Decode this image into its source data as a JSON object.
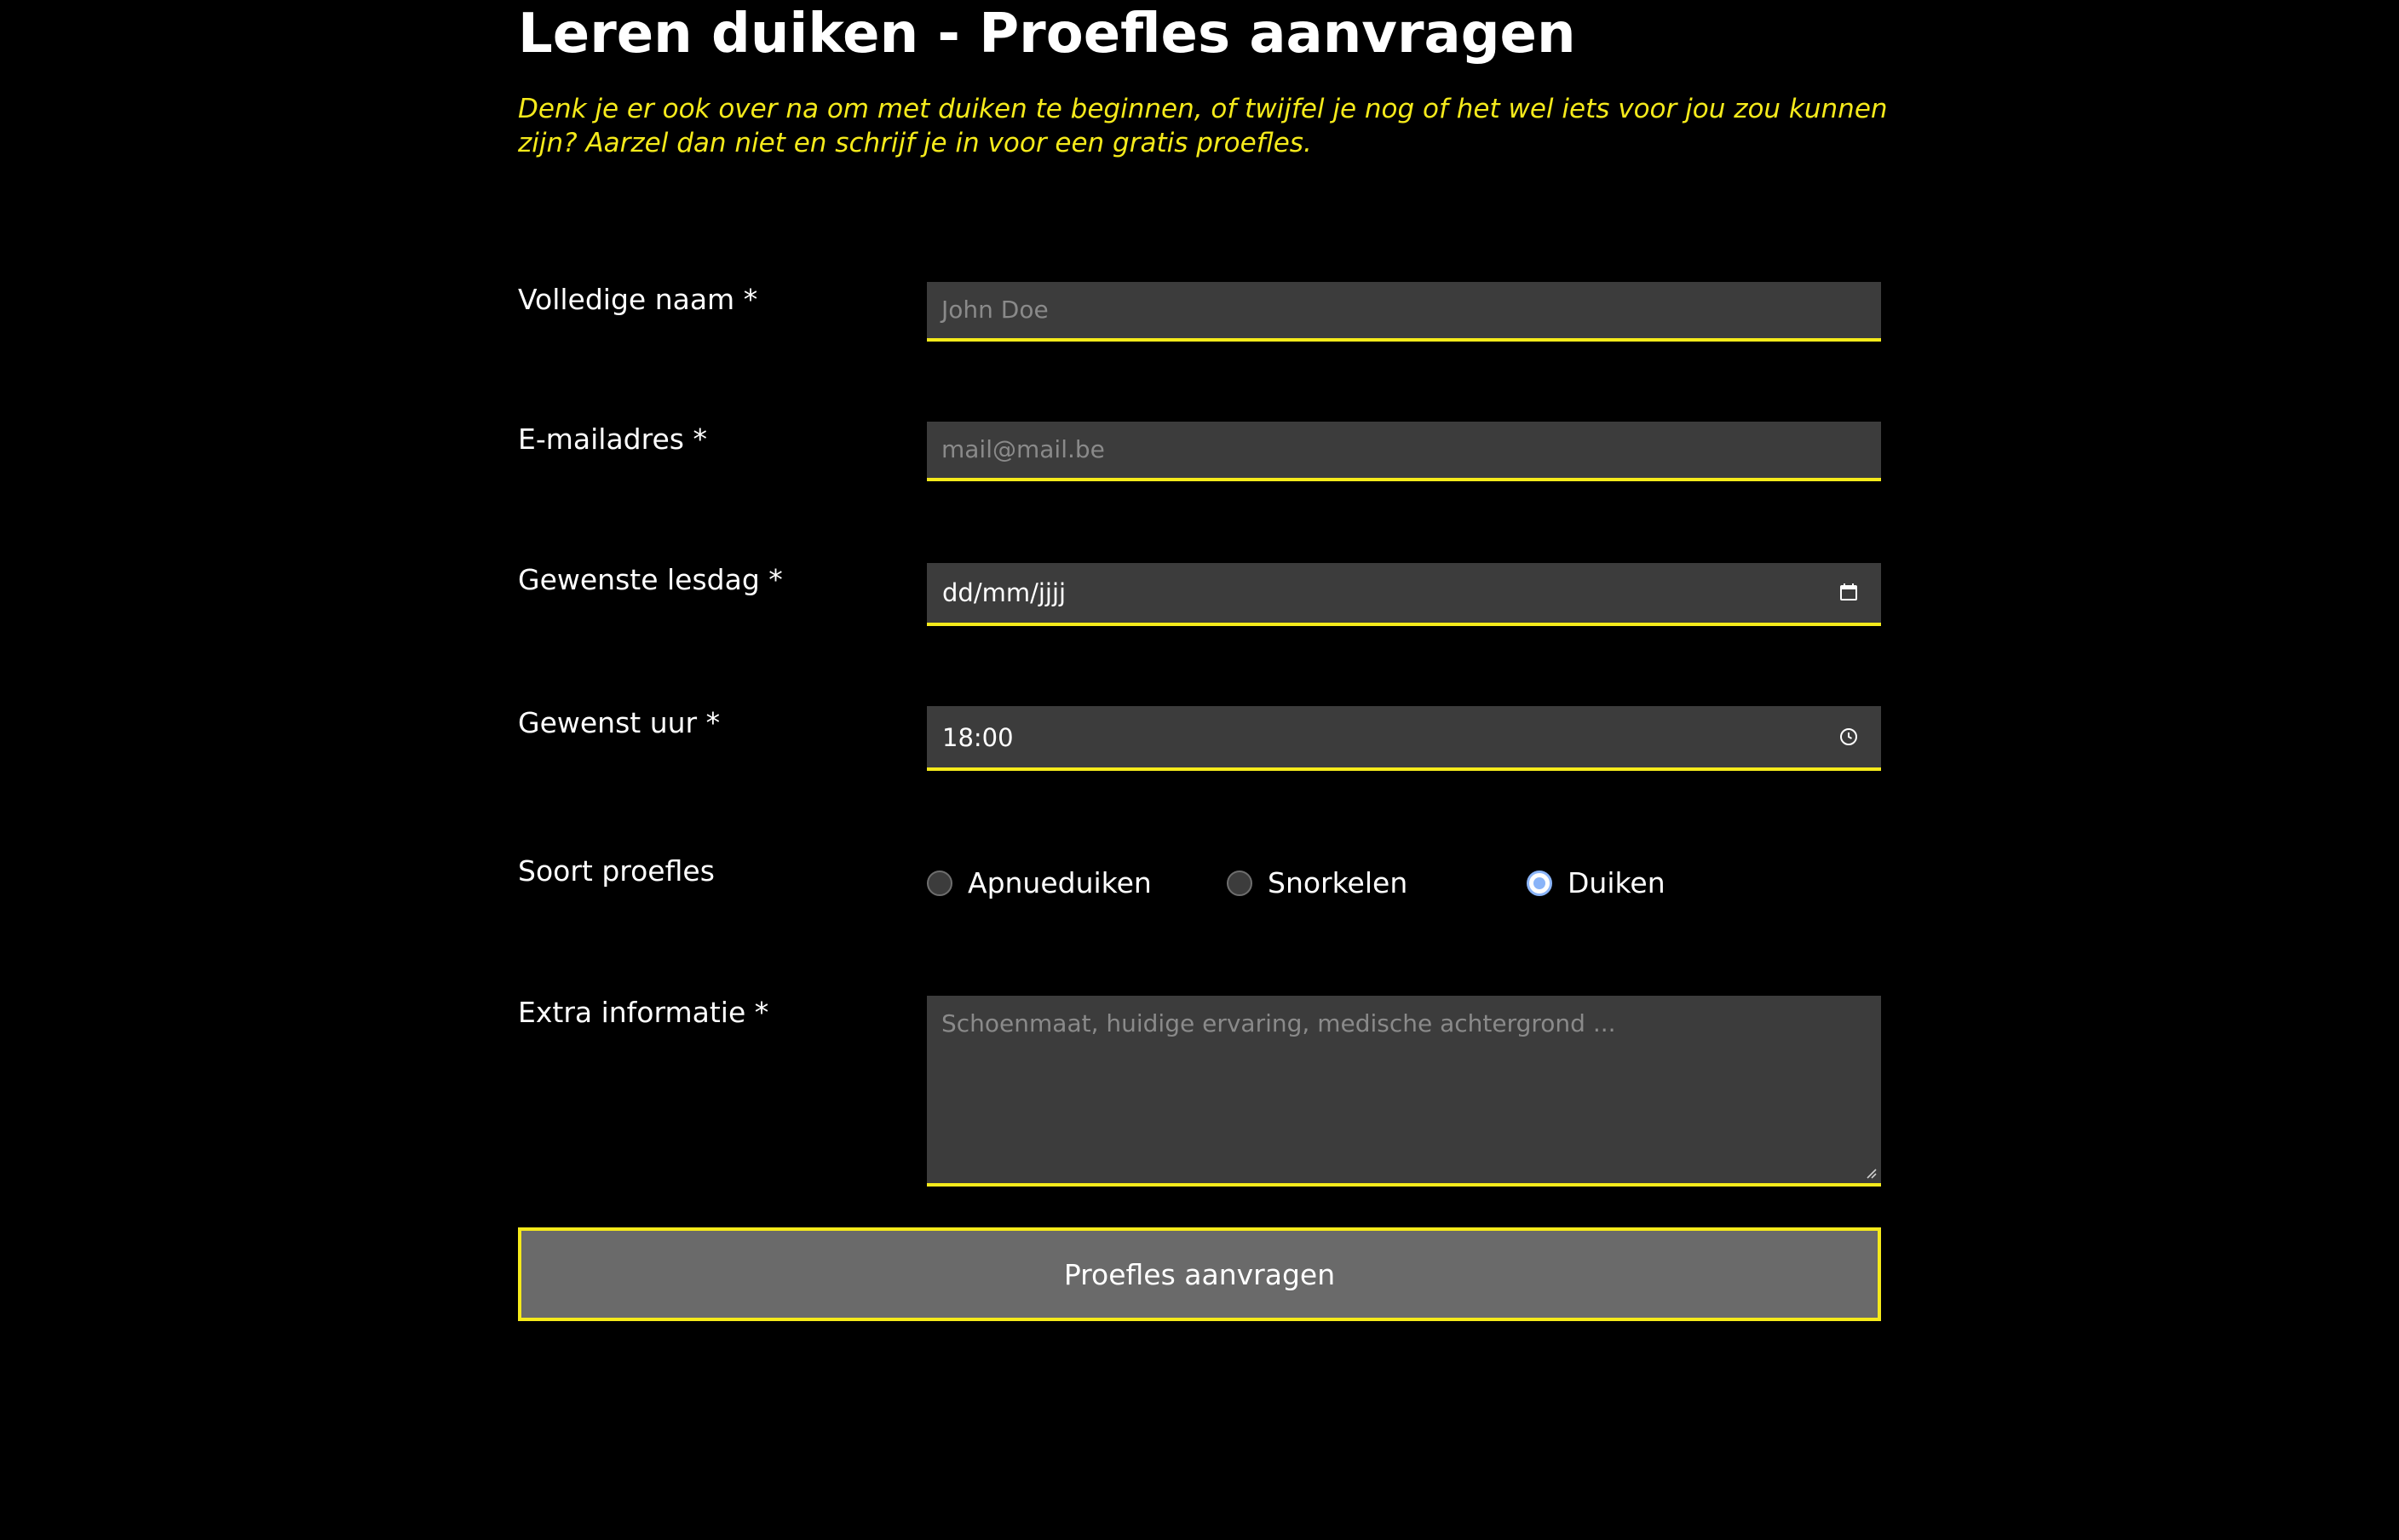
{
  "page": {
    "title": "Leren duiken - Proefles aanvragen",
    "intro": "Denk je er ook over na om met duiken te beginnen, of twijfel je nog of het wel iets voor jou zou kunnen zijn? Aarzel dan niet en schrijf je in voor een gratis proefles."
  },
  "form": {
    "name": {
      "label": "Volledige naam *",
      "placeholder": "John Doe",
      "value": ""
    },
    "email": {
      "label": "E-mailadres *",
      "placeholder": "mail@mail.be",
      "value": ""
    },
    "date": {
      "label": "Gewenste lesdag *",
      "display": "dd/mm/jjjj",
      "icon": "calendar-icon"
    },
    "time": {
      "label": "Gewenst uur *",
      "value": "18:00",
      "icon": "clock-icon"
    },
    "lesson_type": {
      "label": "Soort proefles",
      "options": [
        "Apnueduiken",
        "Snorkelen",
        "Duiken"
      ],
      "selected": "Duiken"
    },
    "extra": {
      "label": "Extra informatie *",
      "placeholder": "Schoenmaat, huidige ervaring, medische achtergrond ...",
      "value": ""
    },
    "submit_label": "Proefles aanvragen"
  },
  "colors": {
    "background": "#000000",
    "accent": "#f5ea1b",
    "field_background": "#3c3c3c",
    "button_background": "#6a6a6a",
    "radio_checked": "#8ab4f8"
  }
}
